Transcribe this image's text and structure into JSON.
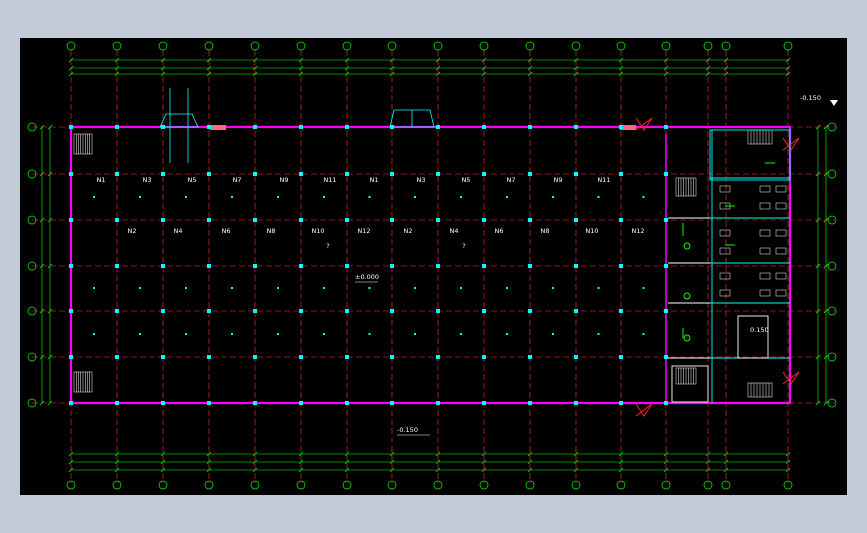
{
  "drawing": {
    "room_labels_top": [
      "N1",
      "N3",
      "N5",
      "N7",
      "N9",
      "N11",
      "N1",
      "N3",
      "N5",
      "N7",
      "N9",
      "N11"
    ],
    "room_labels_bottom": [
      "N2",
      "N4",
      "N6",
      "N8",
      "N10",
      "N12",
      "N2",
      "N4",
      "N6",
      "N8",
      "N10",
      "N12"
    ],
    "elevation_floor": "±0.000",
    "elevation_outside": "-0.150",
    "elevation_bottom": "-0.150",
    "elevation_office": "0.150",
    "unknown_mark": "?",
    "colors": {
      "background": "#000000",
      "frame": "#c3cad7",
      "wall": "#ff00ff",
      "grid": "#ff3333",
      "dimension": "#00ff00",
      "column": "#00ffff",
      "text": "#ffffff"
    }
  }
}
